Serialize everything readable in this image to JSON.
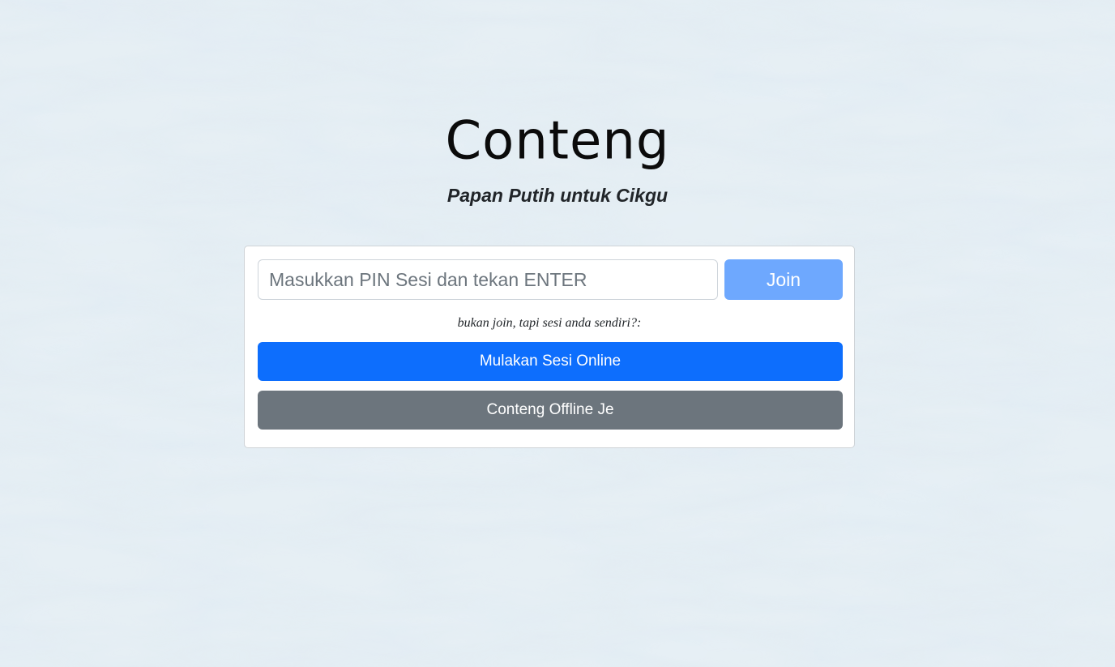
{
  "header": {
    "title": "Conteng",
    "subtitle": "Papan Putih untuk Cikgu"
  },
  "join_form": {
    "pin_placeholder": "Masukkan PIN Sesi dan tekan ENTER",
    "pin_value": "",
    "join_label": "Join"
  },
  "alternatives": {
    "hint": "bukan join, tapi sesi anda sendiri?:",
    "online_label": "Mulakan Sesi Online",
    "offline_label": "Conteng Offline Je"
  },
  "colors": {
    "background": "#e5eff4",
    "join_button": "#6ea8fe",
    "primary": "#0d6efd",
    "secondary": "#6c757d",
    "text": "#212529"
  }
}
